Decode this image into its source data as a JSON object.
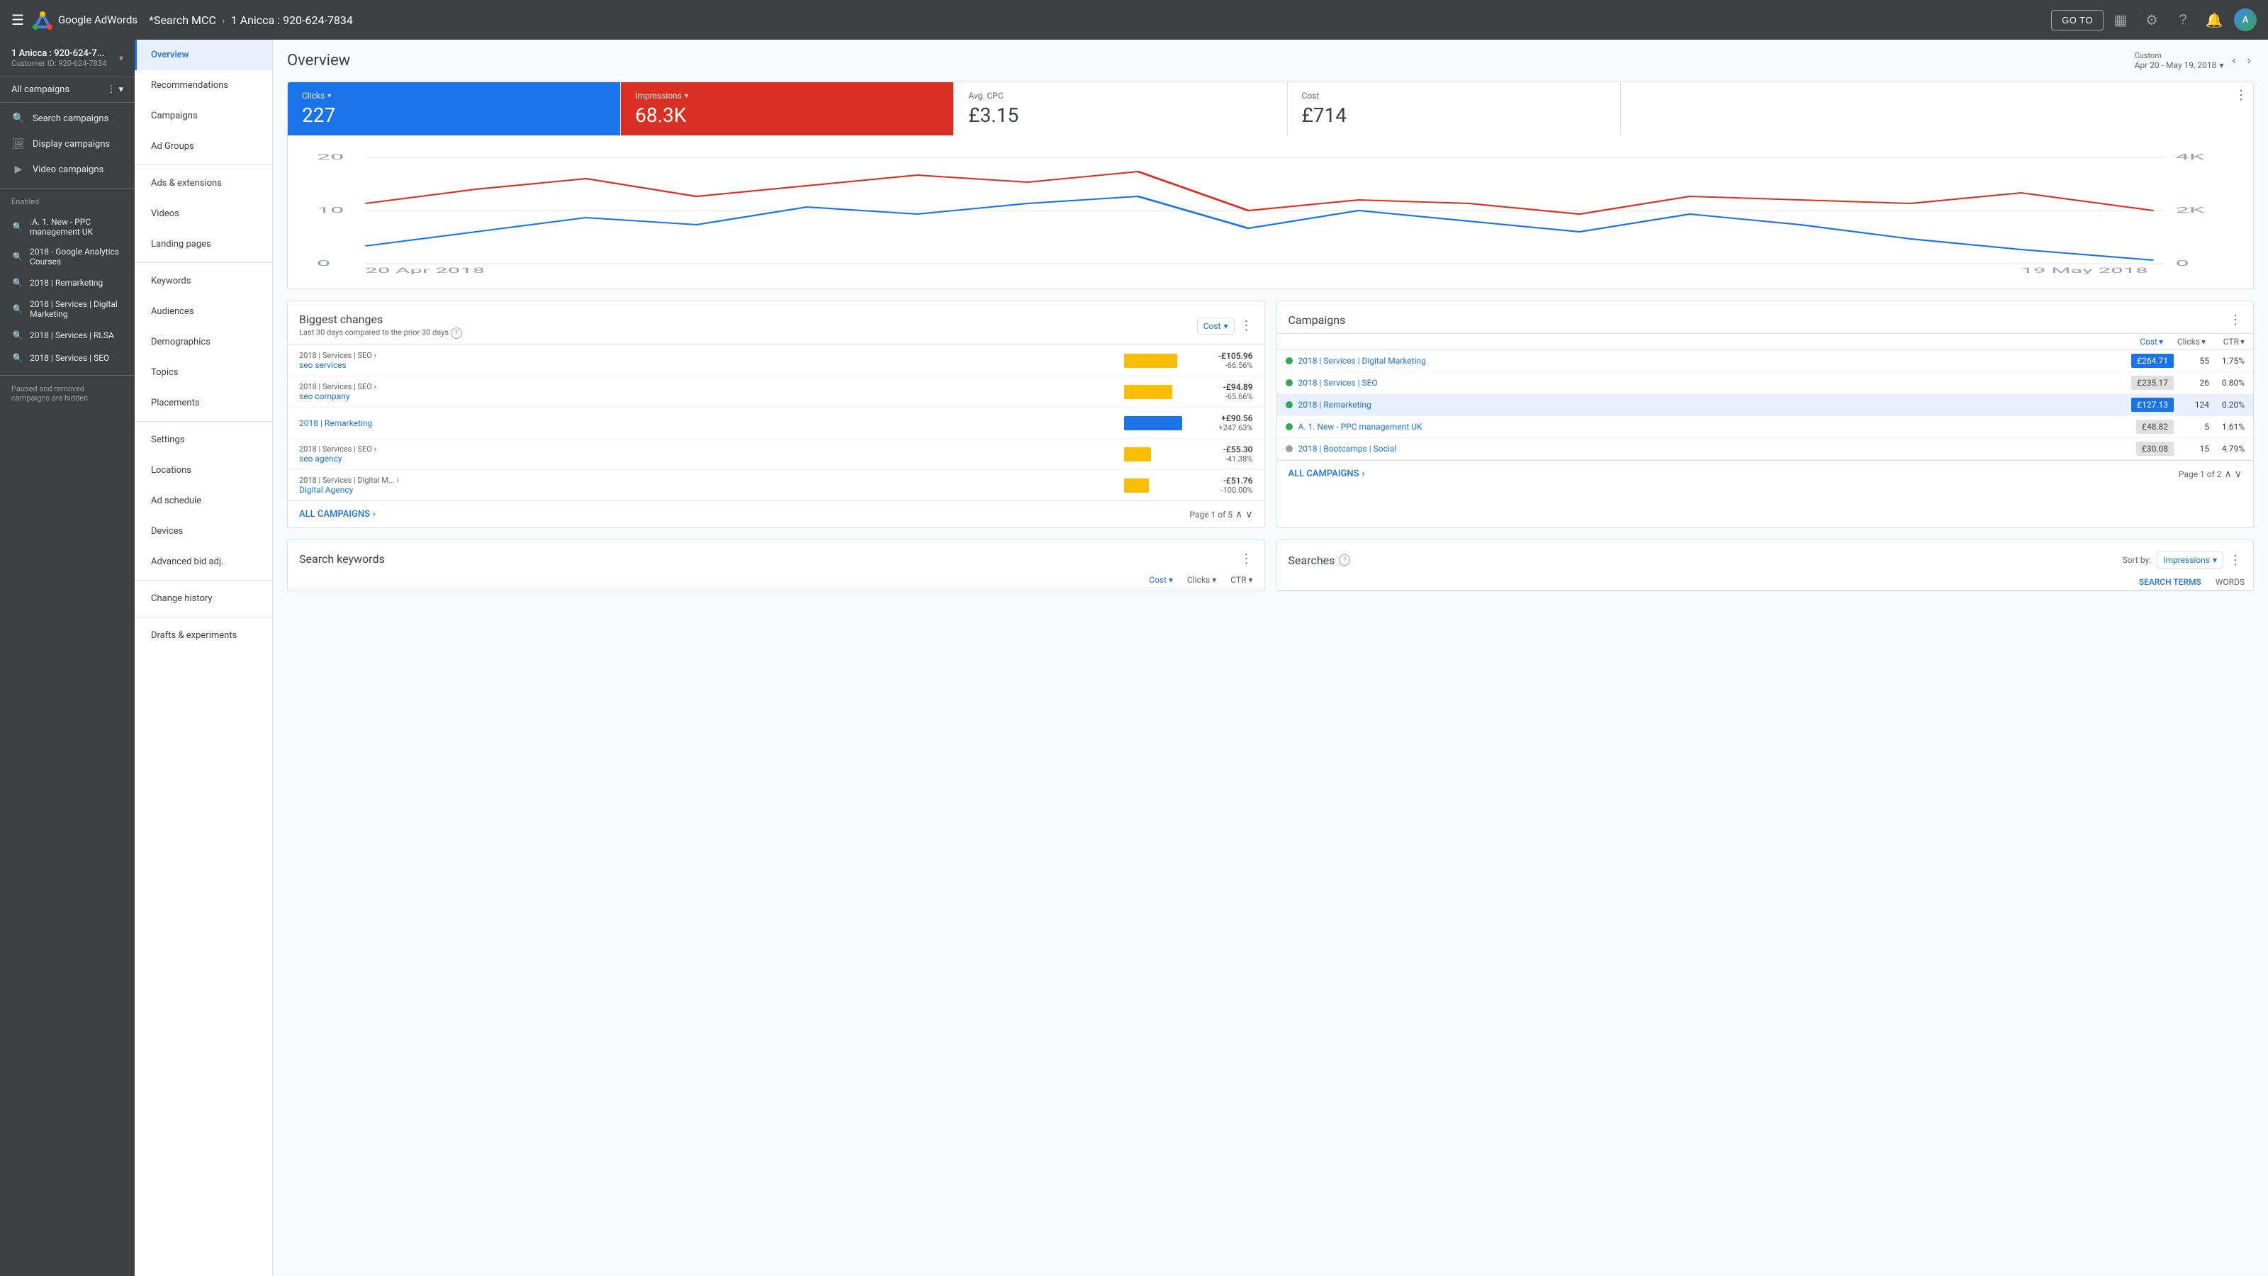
{
  "topNav": {
    "logoText": "Google AdWords",
    "menuIcon": "☰",
    "breadcrumb": {
      "mcc": "*Search MCC",
      "chevron": "›",
      "account": "1 Anicca : 920-624-7834"
    },
    "gotoLabel": "GO TO",
    "icons": {
      "columns": "▦",
      "wrench": "🔧",
      "help": "?",
      "bell": "🔔",
      "avatar": "A"
    }
  },
  "leftSidebar": {
    "accountName": "1 Anicca : 920-624-7...",
    "customerId": "Customer ID: 920-624-7834",
    "allCampaigns": "All campaigns",
    "topItems": [
      {
        "id": "search-campaigns",
        "label": "Search campaigns",
        "icon": "🔍"
      },
      {
        "id": "display-campaigns",
        "label": "Display campaigns",
        "icon": "🖼"
      },
      {
        "id": "video-campaigns",
        "label": "Video campaigns",
        "icon": "▶"
      }
    ],
    "enabledLabel": "Enabled",
    "campaigns": [
      {
        "id": "ppc-uk",
        "label": ".A. 1. New - PPC management UK",
        "icon": "🔍"
      },
      {
        "id": "analytics-courses",
        "label": "2018 - Google Analytics Courses",
        "icon": "🔍"
      },
      {
        "id": "remarketing",
        "label": "2018 | Remarketing",
        "icon": "🔍"
      },
      {
        "id": "services-digital",
        "label": "2018 | Services | Digital Marketing",
        "icon": "🔍"
      },
      {
        "id": "services-rlsa",
        "label": "2018 | Services | RLSA",
        "icon": "🔍"
      },
      {
        "id": "services-seo",
        "label": "2018 | Services | SEO",
        "icon": "🔍"
      }
    ],
    "pausedNote": "Paused and removed campaigns are hidden"
  },
  "midNav": {
    "items": [
      {
        "id": "overview",
        "label": "Overview",
        "active": true
      },
      {
        "id": "recommendations",
        "label": "Recommendations",
        "active": false
      },
      {
        "id": "campaigns",
        "label": "Campaigns",
        "active": false
      },
      {
        "id": "ad-groups",
        "label": "Ad Groups",
        "active": false
      },
      {
        "id": "ads-extensions",
        "label": "Ads & extensions",
        "active": false
      },
      {
        "id": "videos",
        "label": "Videos",
        "active": false
      },
      {
        "id": "landing-pages",
        "label": "Landing pages",
        "active": false
      },
      {
        "id": "keywords",
        "label": "Keywords",
        "active": false
      },
      {
        "id": "audiences",
        "label": "Audiences",
        "active": false
      },
      {
        "id": "demographics",
        "label": "Demographics",
        "active": false
      },
      {
        "id": "topics",
        "label": "Topics",
        "active": false
      },
      {
        "id": "placements",
        "label": "Placements",
        "active": false
      },
      {
        "id": "settings",
        "label": "Settings",
        "active": false
      },
      {
        "id": "locations",
        "label": "Locations",
        "active": false
      },
      {
        "id": "ad-schedule",
        "label": "Ad schedule",
        "active": false
      },
      {
        "id": "devices",
        "label": "Devices",
        "active": false
      },
      {
        "id": "advanced-bid",
        "label": "Advanced bid adj.",
        "active": false
      },
      {
        "id": "change-history",
        "label": "Change history",
        "active": false
      },
      {
        "id": "drafts-experiments",
        "label": "Drafts & experiments",
        "active": false
      }
    ]
  },
  "content": {
    "title": "Overview",
    "dateRange": {
      "customLabel": "Custom",
      "dateText": "Apr 20 - May 19, 2018"
    },
    "stats": [
      {
        "id": "clicks",
        "label": "Clicks",
        "value": "227",
        "type": "blue"
      },
      {
        "id": "impressions",
        "label": "Impressions",
        "value": "68.3K",
        "type": "red"
      },
      {
        "id": "avg-cpc",
        "label": "Avg. CPC",
        "value": "£3.15",
        "type": "normal"
      },
      {
        "id": "cost",
        "label": "Cost",
        "value": "£714",
        "type": "normal"
      }
    ],
    "chart": {
      "xLabels": [
        "20 Apr 2018",
        "19 May 2018"
      ],
      "yLeftMax": "20",
      "yLeftMid": "10",
      "yLeftMin": "0",
      "yRightMax": "4K",
      "yRightMid": "2K",
      "yRightMin": "0"
    },
    "biggestChanges": {
      "title": "Biggest changes",
      "subtitle": "Last 30 days compared to the prior 30 days",
      "sortLabel": "Cost",
      "rows": [
        {
          "parent": "2018 | Services | SEO ›",
          "item": "seo services",
          "barColor": "#fbbc04",
          "barWidth": 75,
          "amount": "-£105.96",
          "pct": "-66.56%"
        },
        {
          "parent": "2018 | Services | SEO ›",
          "item": "seo company",
          "barColor": "#fbbc04",
          "barWidth": 68,
          "amount": "-£94.89",
          "pct": "-65.66%"
        },
        {
          "parent": "",
          "item": "2018 | Remarketing",
          "barColor": "#1a73e8",
          "barWidth": 82,
          "amount": "+£90.56",
          "pct": "+247.63%"
        },
        {
          "parent": "2018 | Services | SEO ›",
          "item": "seo agency",
          "barColor": "#fbbc04",
          "barWidth": 38,
          "amount": "-£55.30",
          "pct": "-41.38%"
        },
        {
          "parent": "2018 | Services | Digital M... ›",
          "item": "Digital Agency",
          "barColor": "#fbbc04",
          "barWidth": 35,
          "amount": "-£51.76",
          "pct": "-100.00%"
        }
      ],
      "allCampaigns": "ALL CAMPAIGNS",
      "pageInfo": "Page 1 of 5"
    },
    "campaigns": {
      "title": "Campaigns",
      "columns": [
        {
          "id": "cost",
          "label": "Cost",
          "active": true
        },
        {
          "id": "clicks",
          "label": "Clicks",
          "active": false
        },
        {
          "id": "ctr",
          "label": "CTR",
          "active": false
        }
      ],
      "rows": [
        {
          "name": "2018 | Services | Digital Marketing",
          "status": "green",
          "cost": "£264.71",
          "costHighlight": true,
          "clicks": "55",
          "ctr": "1.75%"
        },
        {
          "name": "2018 | Services | SEO",
          "status": "green",
          "cost": "£235.17",
          "costHighlight": false,
          "clicks": "26",
          "ctr": "0.80%"
        },
        {
          "name": "2018 | Remarketing",
          "status": "green",
          "cost": "£127.13",
          "costHighlight": true,
          "clicks": "124",
          "ctr": "0.20%"
        },
        {
          "name": "A. 1. New - PPC management UK",
          "status": "green",
          "cost": "£48.82",
          "costHighlight": false,
          "clicks": "5",
          "ctr": "1.61%"
        },
        {
          "name": "2018 | Bootcamps | Social",
          "status": "gray",
          "cost": "£30.08",
          "costHighlight": false,
          "clicks": "15",
          "ctr": "4.79%"
        }
      ],
      "allCampaigns": "ALL CAMPAIGNS",
      "pageInfo": "Page 1 of 2"
    },
    "searchKeywords": {
      "title": "Search keywords",
      "columns": [
        "Cost",
        "Clicks",
        "CTR"
      ]
    },
    "searches": {
      "title": "Searches",
      "sortLabel": "Sort by:",
      "sortValue": "Impressions",
      "tabLabels": [
        "SEARCH TERMS",
        "WORDS"
      ]
    }
  }
}
